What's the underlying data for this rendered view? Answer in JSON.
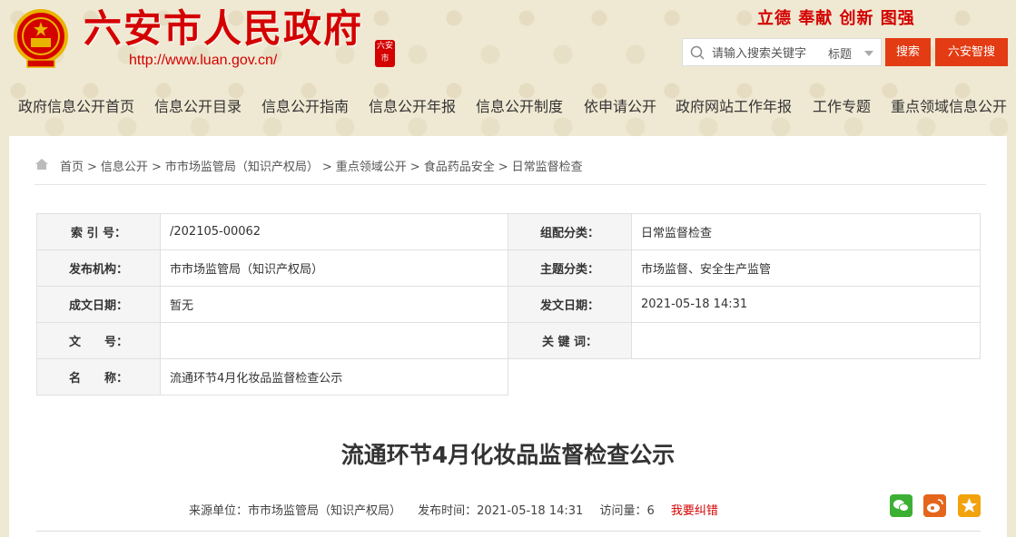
{
  "header": {
    "site_title": "六安市人民政府",
    "site_url": "http://www.luan.gov.cn/",
    "seal_text": "六安市",
    "slogan": "立德  奉献  创新  图强",
    "search": {
      "placeholder": "请输入搜索关键字",
      "scope": "标题",
      "search_button": "搜索",
      "smart_button": "六安智搜"
    }
  },
  "nav": {
    "items": [
      "政府信息公开首页",
      "信息公开目录",
      "信息公开指南",
      "信息公开年报",
      "信息公开制度",
      "依申请公开",
      "政府网站工作年报",
      "工作专题",
      "重点领域信息公开"
    ]
  },
  "breadcrumb": {
    "items": [
      "首页",
      "信息公开",
      "市市场监管局（知识产权局）",
      "重点领域公开",
      "食品药品安全",
      "日常监督检查"
    ],
    "separator": ">"
  },
  "meta": {
    "index_label": "索 引 号：",
    "index_value": "/202105-00062",
    "category_label": "组配分类：",
    "category_value": "日常监督检查",
    "publisher_label": "发布机构：",
    "publisher_value": "市市场监管局（知识产权局）",
    "topic_label": "主题分类：",
    "topic_value": "市场监督、安全生产监管",
    "created_label": "成文日期：",
    "created_value": "暂无",
    "published_label": "发文日期：",
    "published_value": "2021-05-18 14:31",
    "docno_label": "文　　号：",
    "docno_value": "",
    "keywords_label": "关 键 词：",
    "keywords_value": "",
    "name_label": "名　　称：",
    "name_value": "流通环节4月化妆品监督检查公示"
  },
  "article": {
    "title": "流通环节4月化妆品监督检查公示",
    "source": "来源单位：市市场监管局（知识产权局）",
    "publish_time": "发布时间：2021-05-18 14:31",
    "views": "访问量：6",
    "report": "我要纠错"
  },
  "colors": {
    "brand_red": "#d40000",
    "button_orange": "#e33b13",
    "wechat": "#3cb034",
    "weibo": "#e5651c",
    "favorite": "#f2a20c"
  }
}
